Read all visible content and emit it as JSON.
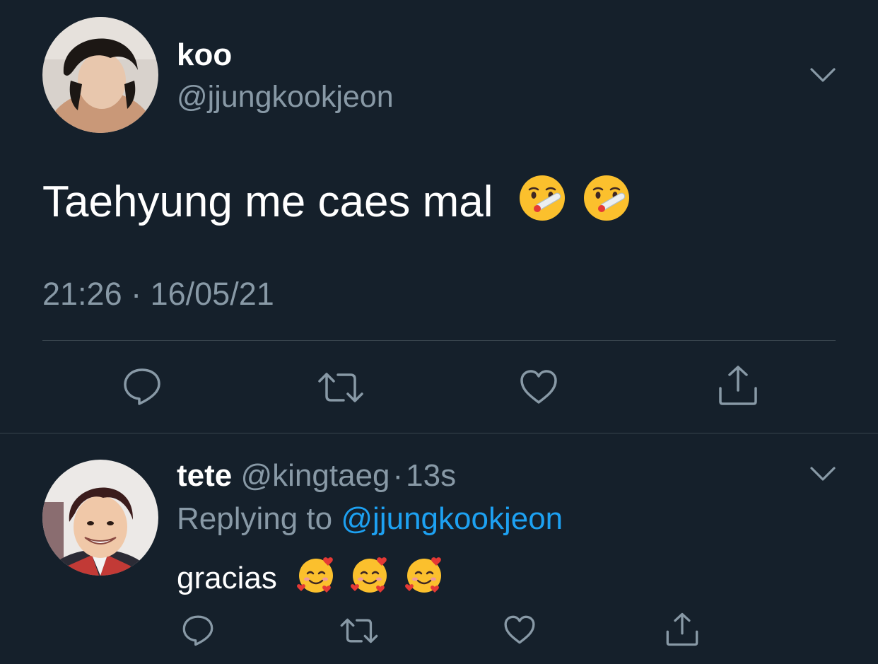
{
  "tweet": {
    "author": {
      "display_name": "koo",
      "handle": "@jjungkookjeon",
      "avatar": "avatar-photo"
    },
    "text": "Taehyung me caes mal",
    "emojis": [
      "face-with-thermometer",
      "face-with-thermometer"
    ],
    "timestamp": "21:26 · 16/05/21",
    "menu_icon": "chevron-down-icon",
    "actions": [
      "reply-icon",
      "retweet-icon",
      "like-icon",
      "share-icon"
    ]
  },
  "reply": {
    "author": {
      "display_name": "tete",
      "handle": "@kingtaeg",
      "avatar": "avatar-photo"
    },
    "separator": "·",
    "time": "13s",
    "replying_to_label": "Replying to",
    "replying_to_handle": "@jjungkookjeon",
    "text": "gracias",
    "emojis": [
      "smiling-face-with-hearts",
      "smiling-face-with-hearts",
      "smiling-face-with-hearts"
    ],
    "menu_icon": "chevron-down-icon",
    "actions": [
      "reply-icon",
      "retweet-icon",
      "like-icon",
      "share-icon"
    ]
  },
  "colors": {
    "background": "#15202b",
    "primary_text": "#ffffff",
    "secondary_text": "#8899a6",
    "link": "#1da1f2",
    "divider": "#38444d"
  }
}
